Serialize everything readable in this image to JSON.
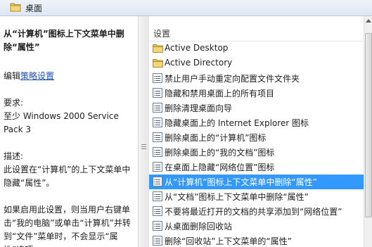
{
  "header": {
    "title": "桌面",
    "icon": "folder-icon"
  },
  "description": {
    "heading": "从“计算机”图标上下文菜单中删除“属性”",
    "edit_prefix": "编辑",
    "edit_link": "策略设置",
    "requirements_label": "要求:",
    "requirements_value": "至少 Windows 2000 Service Pack 3",
    "description_label": "描述:",
    "description_text": "此设置在“计算机”的上下文菜单中隐藏“属性”。",
    "detail_text": "如果启用此设置，则当用户右键单击“我的电脑”或单击“计算机”并转到“文件”菜单时，不会显示“属性”选项。"
  },
  "list": {
    "column_header": "设置",
    "selected_index": 9,
    "items": [
      {
        "label": "Active Desktop",
        "type": "folder"
      },
      {
        "label": "Active Directory",
        "type": "folder"
      },
      {
        "label": "禁止用户手动重定向配置文件文件夹",
        "type": "policy"
      },
      {
        "label": "隐藏和禁用桌面上的所有项目",
        "type": "policy"
      },
      {
        "label": "删除清理桌面向导",
        "type": "policy"
      },
      {
        "label": "隐藏桌面上的 Internet Explorer 图标",
        "type": "policy"
      },
      {
        "label": "删除桌面上的“计算机”图标",
        "type": "policy"
      },
      {
        "label": "删除桌面上的“我的文档”图标",
        "type": "policy"
      },
      {
        "label": "在桌面上隐藏“网络位置”图标",
        "type": "policy"
      },
      {
        "label": "从“计算机”图标上下文菜单中删除“属性”",
        "type": "policy"
      },
      {
        "label": "从“文档”图标上下文菜单中删除“属性”",
        "type": "policy"
      },
      {
        "label": "不要将最近打开的文档的共享添加到“网络位置”",
        "type": "policy"
      },
      {
        "label": "从桌面删除回收站",
        "type": "policy"
      },
      {
        "label": "删除“回收站”上下文菜单的“属性”",
        "type": "policy"
      }
    ]
  },
  "colors": {
    "selection": "#3399ff",
    "link": "#1a4fbb",
    "folder": "#e8c15a"
  }
}
